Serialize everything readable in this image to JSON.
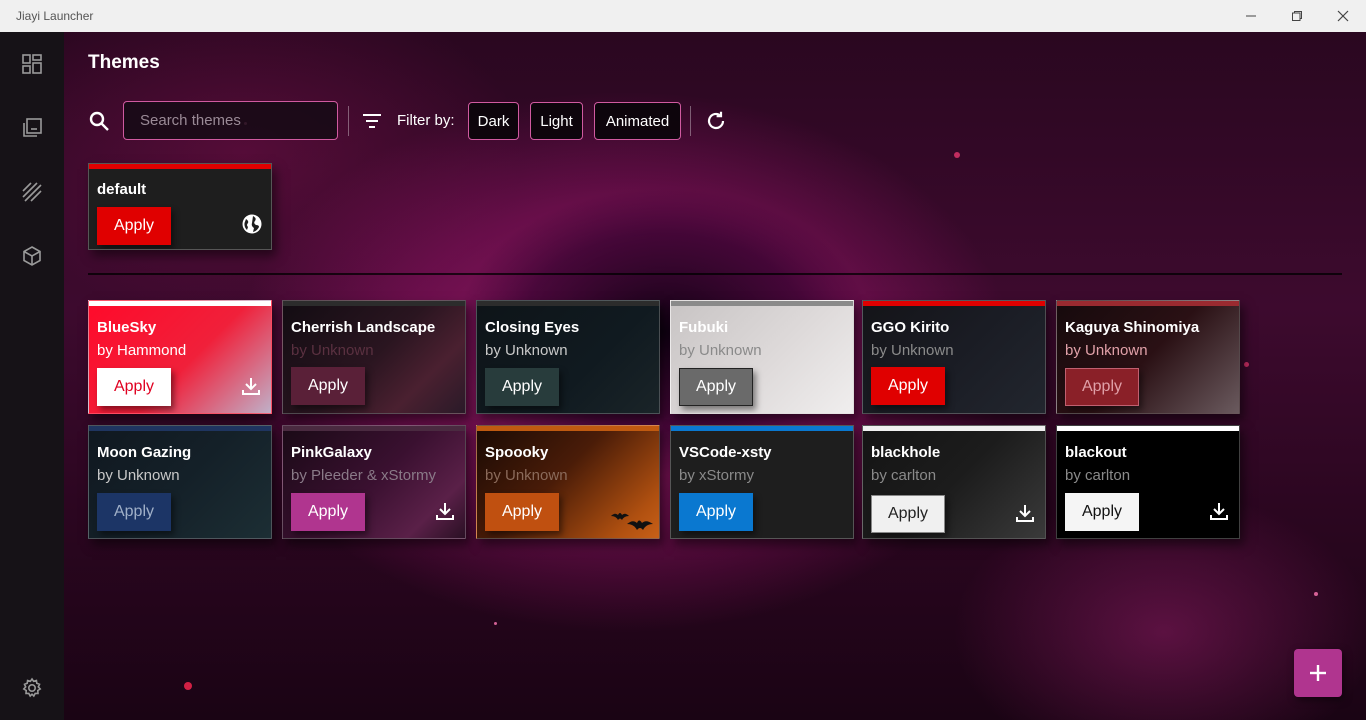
{
  "window": {
    "title": "Jiayi Launcher"
  },
  "sidebar": {
    "items": [
      {
        "icon": "dashboard-icon"
      },
      {
        "icon": "library-icon"
      },
      {
        "icon": "themes-icon"
      },
      {
        "icon": "package-icon"
      }
    ],
    "settings_icon": "gear-icon"
  },
  "page": {
    "title": "Themes"
  },
  "toolbar": {
    "search_placeholder": "Search themes",
    "filter_label": "Filter by:",
    "filters": [
      "Dark",
      "Light",
      "Animated"
    ]
  },
  "default_theme": {
    "name": "default",
    "apply_label": "Apply",
    "bar_color": "#e00000",
    "button_color": "#e00000"
  },
  "themes": [
    {
      "name": "BlueSky",
      "author": "by Hammond",
      "apply_label": "Apply",
      "bar": "#ffffff",
      "downloadable": true
    },
    {
      "name": "Cherrish Landscape",
      "author": "by Unknown",
      "apply_label": "Apply",
      "bar": "#2c2c2c",
      "downloadable": false
    },
    {
      "name": "Closing Eyes",
      "author": "by Unknown",
      "apply_label": "Apply",
      "bar": "#2c2c2c",
      "downloadable": false
    },
    {
      "name": "Fubuki",
      "author": "by Unknown",
      "apply_label": "Apply",
      "bar": "#8a8a8a",
      "downloadable": false
    },
    {
      "name": "GGO Kirito",
      "author": "by Unknown",
      "apply_label": "Apply",
      "bar": "#e00000",
      "downloadable": false
    },
    {
      "name": "Kaguya Shinomiya",
      "author": "by Unknown",
      "apply_label": "Apply",
      "bar": "#9a2a30",
      "downloadable": false
    },
    {
      "name": "Moon Gazing",
      "author": "by Unknown",
      "apply_label": "Apply",
      "bar": "#1f3560",
      "downloadable": false
    },
    {
      "name": "PinkGalaxy",
      "author": "by Pleeder & xStormy",
      "apply_label": "Apply",
      "bar": "#4a2a40",
      "downloadable": true
    },
    {
      "name": "Spoooky",
      "author": "by Unknown",
      "apply_label": "Apply",
      "bar": "#c05a10",
      "downloadable": false
    },
    {
      "name": "VSCode-xsty",
      "author": "by xStormy",
      "apply_label": "Apply",
      "bar": "#0a78d0",
      "downloadable": false
    },
    {
      "name": "blackhole",
      "author": "by carlton",
      "apply_label": "Apply",
      "bar": "#f0f0f0",
      "downloadable": true
    },
    {
      "name": "blackout",
      "author": "by carlton",
      "apply_label": "Apply",
      "bar": "#ffffff",
      "downloadable": true
    }
  ],
  "fab": {
    "icon": "plus-icon"
  },
  "colors": {
    "accent": "#d05aa0",
    "fab": "#b0358f"
  }
}
